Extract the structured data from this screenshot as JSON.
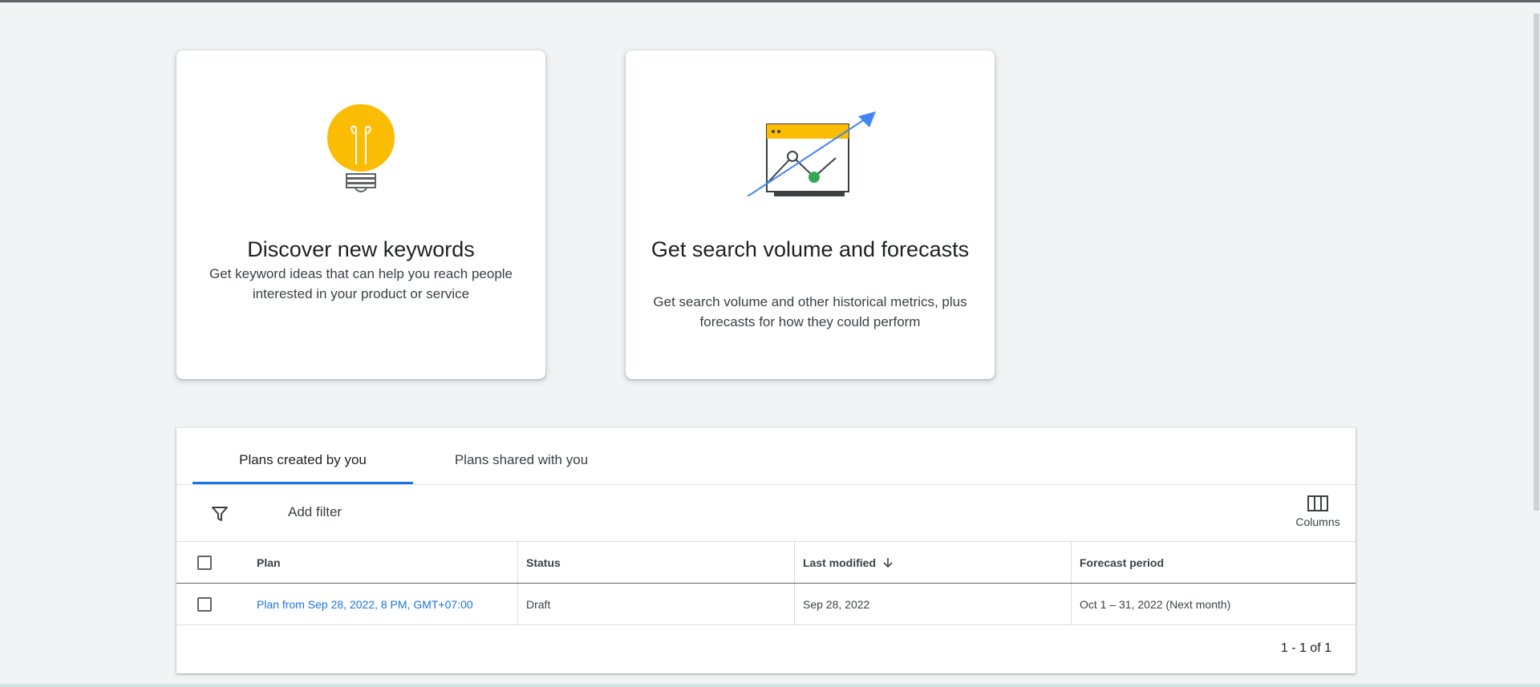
{
  "cards": [
    {
      "title": "Discover new keywords",
      "description": "Get keyword ideas that can help you reach people interested in your product or service",
      "icon": "lightbulb-icon"
    },
    {
      "title": "Get search volume and forecasts",
      "description": "Get search volume and other historical metrics, plus forecasts for how they could perform",
      "icon": "forecast-chart-icon"
    }
  ],
  "tabs": {
    "created": "Plans created by you",
    "shared": "Plans shared with you"
  },
  "filter": {
    "add_filter": "Add filter",
    "columns": "Columns"
  },
  "table": {
    "headers": {
      "plan": "Plan",
      "status": "Status",
      "last_modified": "Last modified",
      "forecast_period": "Forecast period"
    },
    "rows": [
      {
        "plan": "Plan from Sep 28, 2022, 8 PM, GMT+07:00",
        "status": "Draft",
        "last_modified": "Sep 28, 2022",
        "forecast_period": "Oct 1 – 31, 2022 (Next month)"
      }
    ]
  },
  "pagination": "1 - 1 of 1",
  "colors": {
    "accent": "#1a73e8",
    "bulb": "#fbbc04",
    "green": "#34a853",
    "background": "#f1f3f4"
  }
}
